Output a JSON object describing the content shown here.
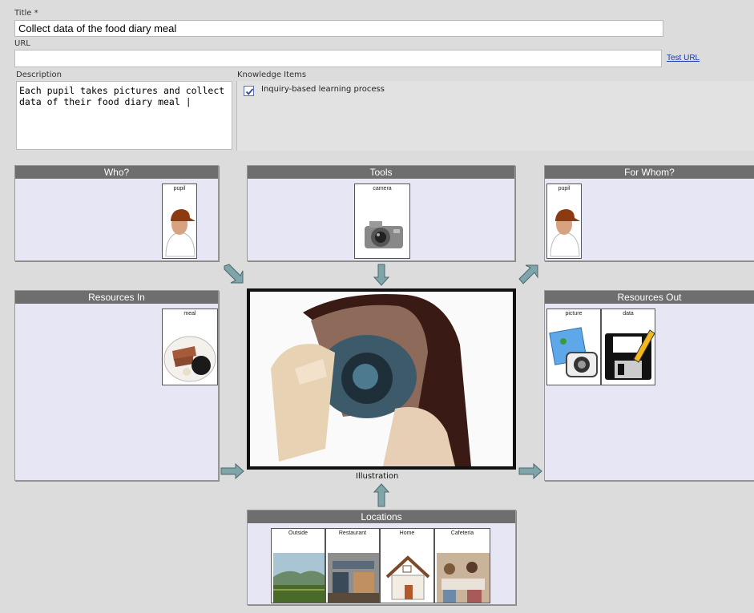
{
  "form": {
    "title_label": "Title *",
    "title_value": "Collect data of the food diary meal",
    "url_label": "URL",
    "url_value": "",
    "test_url": "Test URL",
    "description_label": "Description",
    "description_value": "Each pupil takes pictures and collect data of their food diary meal |",
    "knowledge_label": "Knowledge Items",
    "knowledge_items": [
      {
        "label": "Inquiry-based learning process",
        "checked": true
      }
    ]
  },
  "panels": {
    "who": {
      "title": "Who?",
      "cards": [
        "pupil"
      ]
    },
    "tools": {
      "title": "Tools",
      "cards": [
        "camera"
      ]
    },
    "for_whom": {
      "title": "For Whom?",
      "cards": [
        "pupil"
      ]
    },
    "resources_in": {
      "title": "Resources In",
      "cards": [
        "meal"
      ]
    },
    "resources_out": {
      "title": "Resources Out",
      "cards": [
        "picture",
        "data"
      ]
    },
    "locations": {
      "title": "Locations",
      "cards": [
        "Outside",
        "Restaurant",
        "Home",
        "Cafeteria"
      ]
    }
  },
  "illustration_label": "Illustration",
  "icons": [
    "person-cap-icon",
    "camera-icon",
    "meal-plate-icon",
    "picture-icon",
    "save-data-icon",
    "landscape-icon",
    "restaurant-icon",
    "house-icon",
    "cafeteria-icon",
    "checkbox-icon",
    "arrow-icon"
  ],
  "colors": {
    "panel_bg": "#e6e6f4",
    "panel_header": "#6e6e6e",
    "arrow": "#7fa4aa",
    "page_bg": "#dcdcdc"
  }
}
